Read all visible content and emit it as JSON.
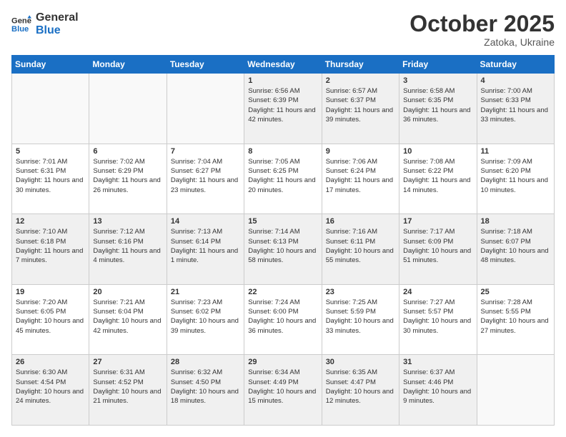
{
  "header": {
    "logo_line1": "General",
    "logo_line2": "Blue",
    "month": "October 2025",
    "location": "Zatoka, Ukraine"
  },
  "days_of_week": [
    "Sunday",
    "Monday",
    "Tuesday",
    "Wednesday",
    "Thursday",
    "Friday",
    "Saturday"
  ],
  "weeks": [
    [
      {
        "day": "",
        "content": ""
      },
      {
        "day": "",
        "content": ""
      },
      {
        "day": "",
        "content": ""
      },
      {
        "day": "1",
        "content": "Sunrise: 6:56 AM\nSunset: 6:39 PM\nDaylight: 11 hours and 42 minutes."
      },
      {
        "day": "2",
        "content": "Sunrise: 6:57 AM\nSunset: 6:37 PM\nDaylight: 11 hours and 39 minutes."
      },
      {
        "day": "3",
        "content": "Sunrise: 6:58 AM\nSunset: 6:35 PM\nDaylight: 11 hours and 36 minutes."
      },
      {
        "day": "4",
        "content": "Sunrise: 7:00 AM\nSunset: 6:33 PM\nDaylight: 11 hours and 33 minutes."
      }
    ],
    [
      {
        "day": "5",
        "content": "Sunrise: 7:01 AM\nSunset: 6:31 PM\nDaylight: 11 hours and 30 minutes."
      },
      {
        "day": "6",
        "content": "Sunrise: 7:02 AM\nSunset: 6:29 PM\nDaylight: 11 hours and 26 minutes."
      },
      {
        "day": "7",
        "content": "Sunrise: 7:04 AM\nSunset: 6:27 PM\nDaylight: 11 hours and 23 minutes."
      },
      {
        "day": "8",
        "content": "Sunrise: 7:05 AM\nSunset: 6:25 PM\nDaylight: 11 hours and 20 minutes."
      },
      {
        "day": "9",
        "content": "Sunrise: 7:06 AM\nSunset: 6:24 PM\nDaylight: 11 hours and 17 minutes."
      },
      {
        "day": "10",
        "content": "Sunrise: 7:08 AM\nSunset: 6:22 PM\nDaylight: 11 hours and 14 minutes."
      },
      {
        "day": "11",
        "content": "Sunrise: 7:09 AM\nSunset: 6:20 PM\nDaylight: 11 hours and 10 minutes."
      }
    ],
    [
      {
        "day": "12",
        "content": "Sunrise: 7:10 AM\nSunset: 6:18 PM\nDaylight: 11 hours and 7 minutes."
      },
      {
        "day": "13",
        "content": "Sunrise: 7:12 AM\nSunset: 6:16 PM\nDaylight: 11 hours and 4 minutes."
      },
      {
        "day": "14",
        "content": "Sunrise: 7:13 AM\nSunset: 6:14 PM\nDaylight: 11 hours and 1 minute."
      },
      {
        "day": "15",
        "content": "Sunrise: 7:14 AM\nSunset: 6:13 PM\nDaylight: 10 hours and 58 minutes."
      },
      {
        "day": "16",
        "content": "Sunrise: 7:16 AM\nSunset: 6:11 PM\nDaylight: 10 hours and 55 minutes."
      },
      {
        "day": "17",
        "content": "Sunrise: 7:17 AM\nSunset: 6:09 PM\nDaylight: 10 hours and 51 minutes."
      },
      {
        "day": "18",
        "content": "Sunrise: 7:18 AM\nSunset: 6:07 PM\nDaylight: 10 hours and 48 minutes."
      }
    ],
    [
      {
        "day": "19",
        "content": "Sunrise: 7:20 AM\nSunset: 6:05 PM\nDaylight: 10 hours and 45 minutes."
      },
      {
        "day": "20",
        "content": "Sunrise: 7:21 AM\nSunset: 6:04 PM\nDaylight: 10 hours and 42 minutes."
      },
      {
        "day": "21",
        "content": "Sunrise: 7:23 AM\nSunset: 6:02 PM\nDaylight: 10 hours and 39 minutes."
      },
      {
        "day": "22",
        "content": "Sunrise: 7:24 AM\nSunset: 6:00 PM\nDaylight: 10 hours and 36 minutes."
      },
      {
        "day": "23",
        "content": "Sunrise: 7:25 AM\nSunset: 5:59 PM\nDaylight: 10 hours and 33 minutes."
      },
      {
        "day": "24",
        "content": "Sunrise: 7:27 AM\nSunset: 5:57 PM\nDaylight: 10 hours and 30 minutes."
      },
      {
        "day": "25",
        "content": "Sunrise: 7:28 AM\nSunset: 5:55 PM\nDaylight: 10 hours and 27 minutes."
      }
    ],
    [
      {
        "day": "26",
        "content": "Sunrise: 6:30 AM\nSunset: 4:54 PM\nDaylight: 10 hours and 24 minutes."
      },
      {
        "day": "27",
        "content": "Sunrise: 6:31 AM\nSunset: 4:52 PM\nDaylight: 10 hours and 21 minutes."
      },
      {
        "day": "28",
        "content": "Sunrise: 6:32 AM\nSunset: 4:50 PM\nDaylight: 10 hours and 18 minutes."
      },
      {
        "day": "29",
        "content": "Sunrise: 6:34 AM\nSunset: 4:49 PM\nDaylight: 10 hours and 15 minutes."
      },
      {
        "day": "30",
        "content": "Sunrise: 6:35 AM\nSunset: 4:47 PM\nDaylight: 10 hours and 12 minutes."
      },
      {
        "day": "31",
        "content": "Sunrise: 6:37 AM\nSunset: 4:46 PM\nDaylight: 10 hours and 9 minutes."
      },
      {
        "day": "",
        "content": ""
      }
    ]
  ]
}
